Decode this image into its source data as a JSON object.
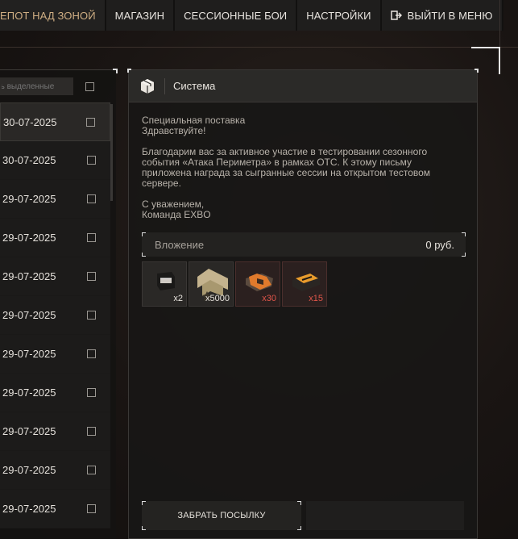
{
  "nav": {
    "items": [
      {
        "label": "ЕПОТ НАД ЗОНОЙ",
        "active": true
      },
      {
        "label": "МАГАЗИН"
      },
      {
        "label": "СЕССИОННЫЕ БОИ"
      },
      {
        "label": "НАСТРОЙКИ"
      },
      {
        "label": "ВЫЙТИ В МЕНЮ",
        "icon": "exit-icon"
      }
    ]
  },
  "mail_list": {
    "filter_placeholder": "ть выделенные",
    "dates": [
      "30-07-2025",
      "30-07-2025",
      "29-07-2025",
      "29-07-2025",
      "29-07-2025",
      "29-07-2025",
      "29-07-2025",
      "29-07-2025",
      "29-07-2025",
      "29-07-2025",
      "29-07-2025"
    ]
  },
  "detail": {
    "header_title": "Система",
    "header_icon": "box-icon",
    "message": {
      "subject": "Специальная поставка",
      "greeting": "Здравствуйте!",
      "body": "Благодарим вас за активное участие в тестировании сезонного события «Атака Периметра» в рамках ОТС. К этому письму приложена награда за сыгранные сессии на открытом тестовом сервере.",
      "sign1": "С уважением,",
      "sign2": "Команда EXBO"
    },
    "attachment_label": "Вложение",
    "attachment_value": "0 руб.",
    "items": [
      {
        "icon": "container-icon",
        "qty": "x2"
      },
      {
        "icon": "rank-icon",
        "qty": "x5000"
      },
      {
        "icon": "orange-crate-icon",
        "qty": "x30",
        "accent": "#e0554a"
      },
      {
        "icon": "gold-crate-icon",
        "qty": "x15",
        "accent": "#e0554a"
      }
    ],
    "claim_label": "ЗАБРАТЬ ПОСЫЛКУ"
  },
  "colors": {
    "accent": "#cfae83",
    "quantity_red": "#e0554a"
  }
}
